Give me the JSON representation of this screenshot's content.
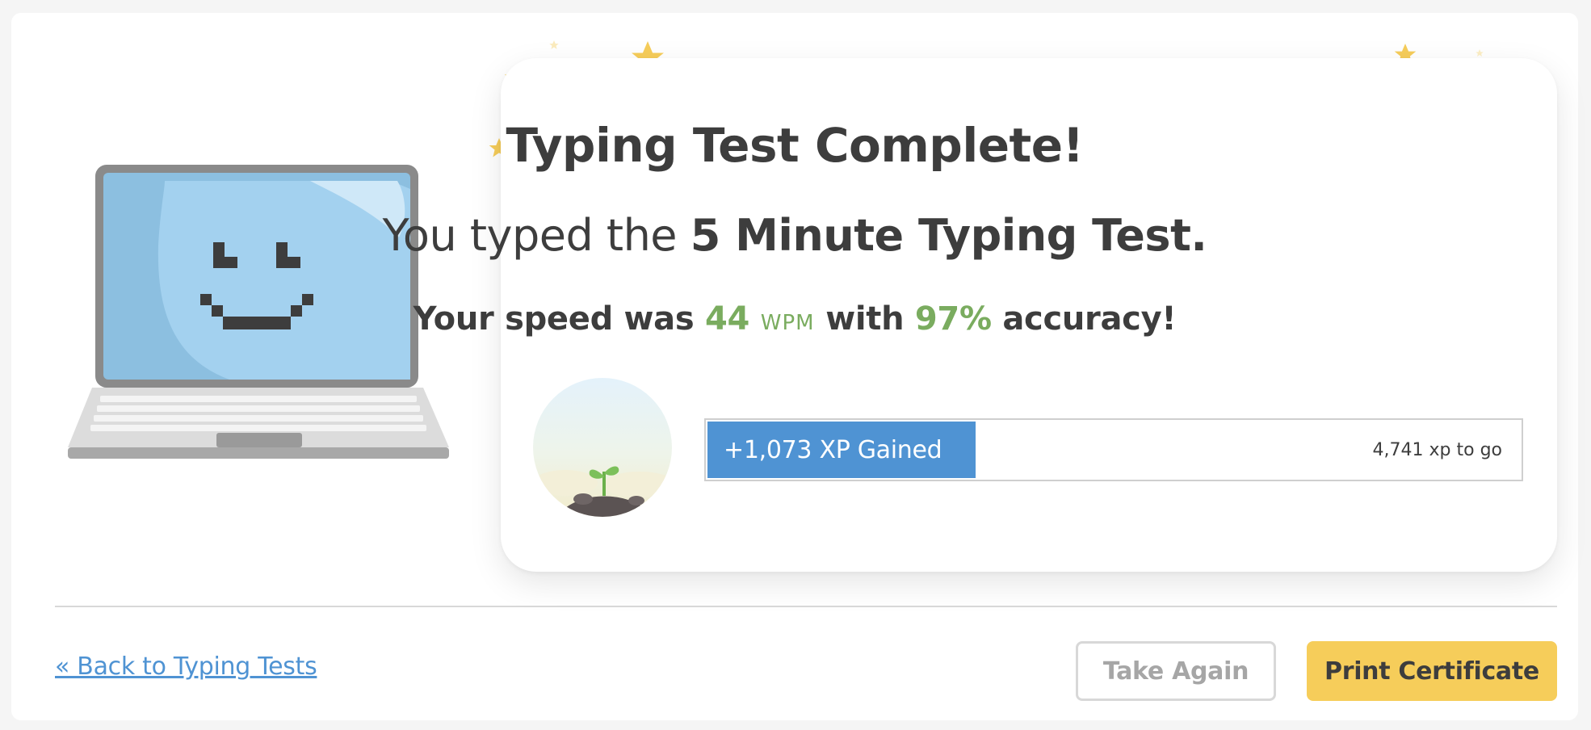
{
  "result": {
    "title": "Typing Test Complete!",
    "subtitle_prefix": "You typed the ",
    "test_name": "5 Minute Typing Test.",
    "speed_prefix": "Your speed was ",
    "wpm_value": "44",
    "wpm_unit": "WPM",
    "speed_middle": " with ",
    "accuracy_value": "97%",
    "speed_suffix": " accuracy!"
  },
  "xp": {
    "gained_label": "+1,073 XP Gained",
    "remaining_label": "4,741 xp to go",
    "progress_fraction": 0.33,
    "fill_color": "#4f93d3"
  },
  "actions": {
    "back_link": "« Back to Typing Tests",
    "take_again": "Take Again",
    "print_certificate": "Print Certificate"
  },
  "colors": {
    "accent_green": "#7aac5f",
    "link_blue": "#4f93d3",
    "primary_button": "#f6cd5a",
    "star_yellow": "#f6cd5a"
  },
  "icons": {
    "mascot": "smiling-laptop-icon",
    "level_badge": "sprout-icon",
    "decoration": "star-icon"
  }
}
